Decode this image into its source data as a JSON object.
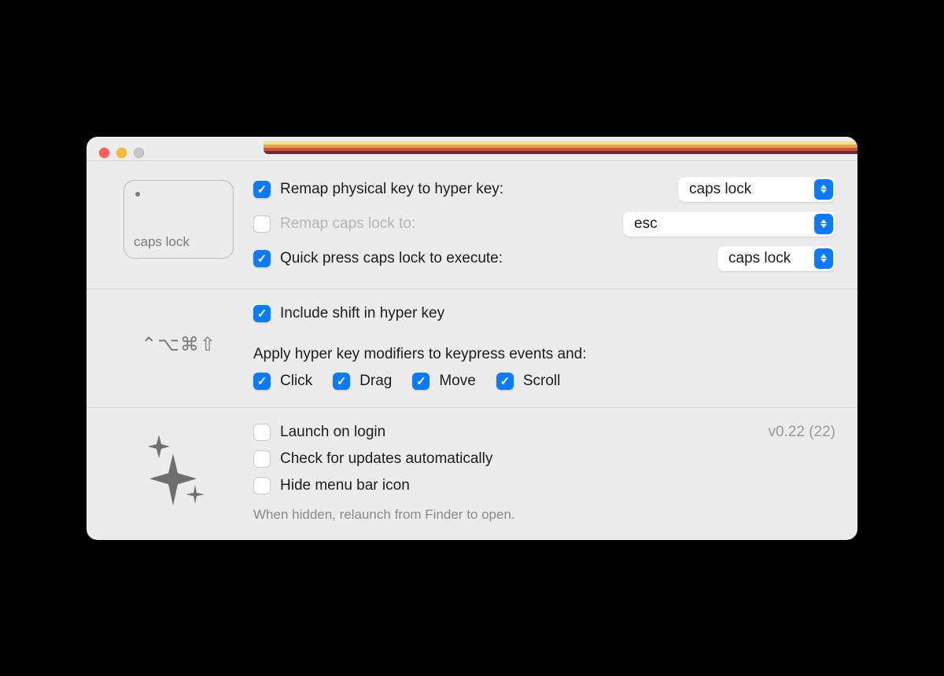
{
  "section1": {
    "keycap_label": "caps lock",
    "remap_to_hyper": {
      "checked": true,
      "label": "Remap physical key to hyper key:"
    },
    "remap_capslock_to": {
      "checked": false,
      "enabled": false,
      "label": "Remap caps lock to:"
    },
    "quick_press": {
      "checked": true,
      "label": "Quick press caps lock to execute:"
    },
    "select_hyper_source": "caps lock",
    "select_capslock_target": "esc",
    "select_quick_press_action": "caps lock"
  },
  "section2": {
    "modifier_glyphs": "⌃⌥⌘⇧",
    "include_shift": {
      "checked": true,
      "label": "Include shift in hyper key"
    },
    "apply_label": "Apply hyper key modifiers to keypress events and:",
    "events": {
      "click": {
        "checked": true,
        "label": "Click"
      },
      "drag": {
        "checked": true,
        "label": "Drag"
      },
      "move": {
        "checked": true,
        "label": "Move"
      },
      "scroll": {
        "checked": true,
        "label": "Scroll"
      }
    }
  },
  "section3": {
    "version": "v0.22 (22)",
    "launch_on_login": {
      "checked": false,
      "label": "Launch on login"
    },
    "check_updates": {
      "checked": false,
      "label": "Check for updates automatically"
    },
    "hide_menubar_icon": {
      "checked": false,
      "label": "Hide menu bar icon"
    },
    "hide_hint": "When hidden, relaunch from Finder to open."
  }
}
